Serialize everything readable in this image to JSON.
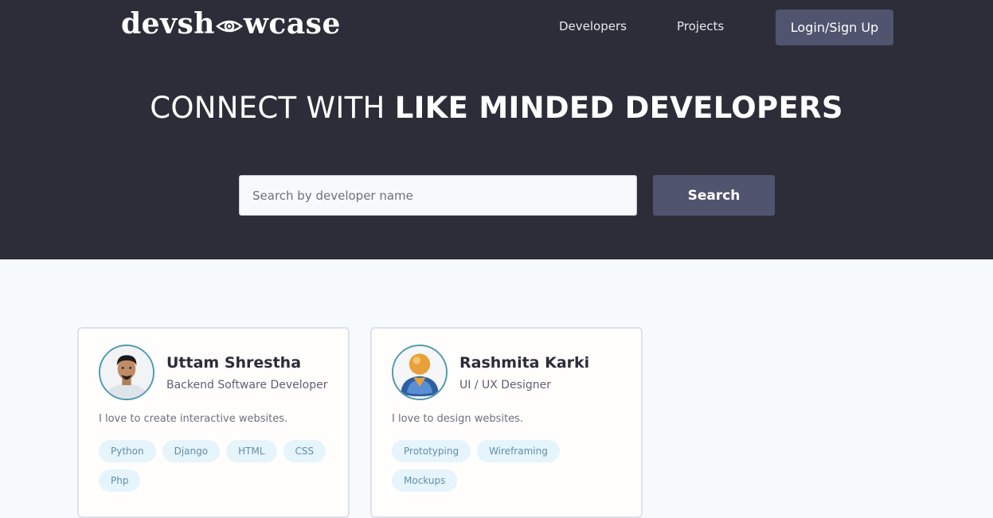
{
  "header": {
    "logo_left": "devsh",
    "logo_right": "wcase",
    "nav": {
      "developers": "Developers",
      "projects": "Projects",
      "login": "Login/Sign Up"
    }
  },
  "hero": {
    "title_light": "CONNECT WITH ",
    "title_bold": "LIKE MINDED DEVELOPERS",
    "search_placeholder": "Search by developer name",
    "search_value": "",
    "search_button": "Search"
  },
  "developers": [
    {
      "name": "Uttam Shrestha",
      "role": "Backend Software Developer",
      "bio": "I love to create interactive websites.",
      "avatar": "photo-avatar",
      "skills": [
        "Python",
        "Django",
        "HTML",
        "CSS",
        "Php"
      ]
    },
    {
      "name": "Rashmita Karki",
      "role": "UI / UX Designer",
      "bio": "I love to design websites.",
      "avatar": "default-user-avatar",
      "skills": [
        "Prototyping",
        "Wireframing",
        "Mockups"
      ]
    }
  ],
  "colors": {
    "hero_bg": "#2d2d39",
    "accent": "#51546e",
    "avatar_ring": "#4d9bb0",
    "tag_bg": "#e6f4fc",
    "tag_text": "#5f8fa6"
  }
}
